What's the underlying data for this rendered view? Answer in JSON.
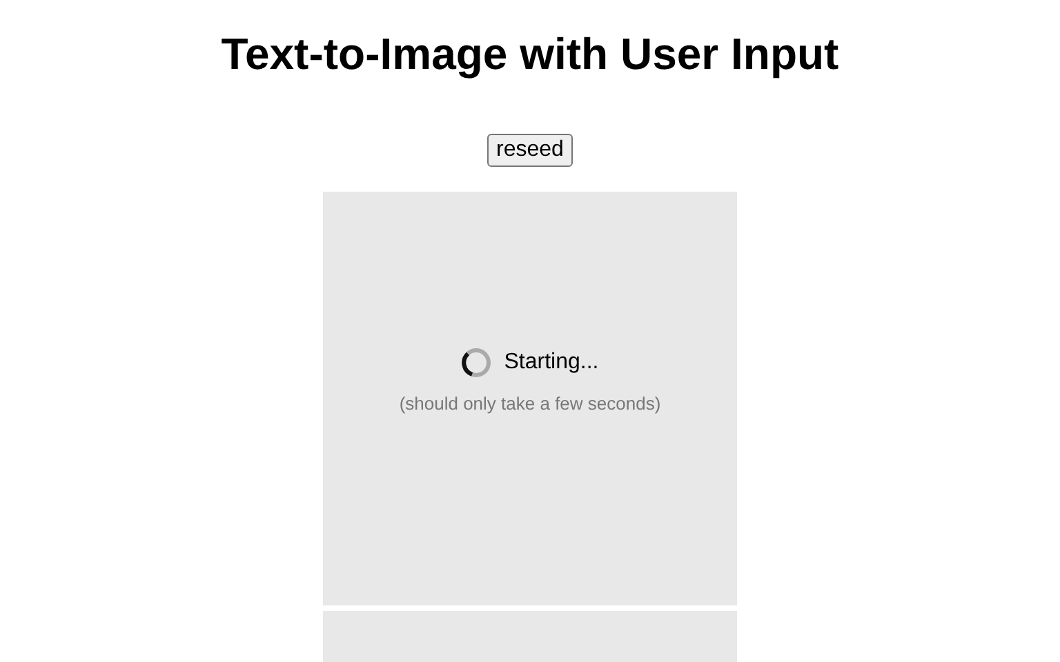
{
  "title": "Text-to-Image with User Input",
  "buttons": [
    "reseed"
  ],
  "loading_panel": {
    "status": "Starting...",
    "hint": "(should only take a few seconds)"
  }
}
